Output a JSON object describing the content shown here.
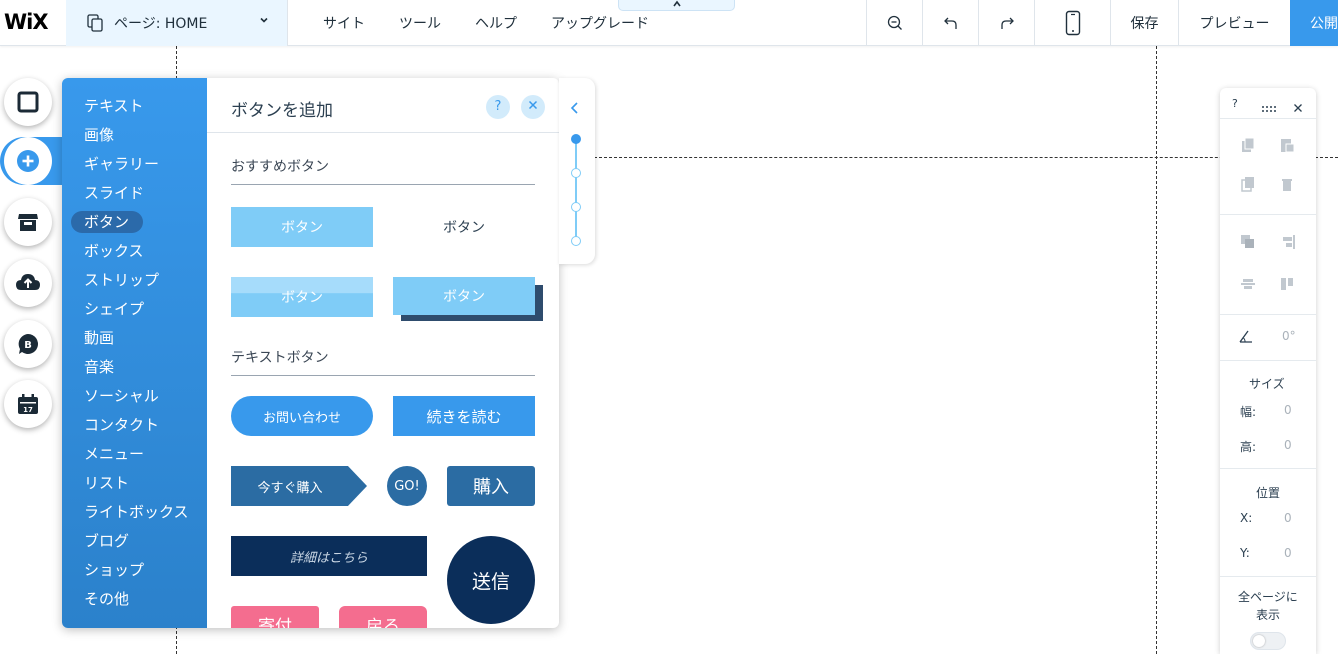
{
  "topbar": {
    "logo": "WiX",
    "page_label": "ページ: HOME",
    "menu": [
      "サイト",
      "ツール",
      "ヘルプ",
      "アップグレード"
    ],
    "save": "保存",
    "preview": "プレビュー",
    "publish": "公開"
  },
  "add_panel": {
    "categories": [
      "テキスト",
      "画像",
      "ギャラリー",
      "スライド",
      "ボタン",
      "ボックス",
      "ストリップ",
      "シェイプ",
      "動画",
      "音楽",
      "ソーシャル",
      "コンタクト",
      "メニュー",
      "リスト",
      "ライトボックス",
      "ブログ",
      "ショップ",
      "その他"
    ],
    "active_category": "ボタン",
    "title": "ボタンを追加",
    "help": "?",
    "section_recommended": "おすすめボタン",
    "section_text": "テキストボタン",
    "buttons": {
      "b1": "ボタン",
      "b2": "ボタン",
      "b3": "ボタン",
      "b4": "ボタン",
      "contact": "お問い合わせ",
      "read_more": "続きを読む",
      "buy_now": "今すぐ購入",
      "go": "GO!",
      "purchase": "購入",
      "details": "詳細はこちら",
      "send": "送信",
      "donate": "寄付",
      "back": "戻る"
    }
  },
  "inspector": {
    "help": "?",
    "rotation_value": "0°",
    "size_title": "サイズ",
    "width_label": "幅:",
    "width_value": "0",
    "height_label": "高:",
    "height_value": "0",
    "position_title": "位置",
    "x_label": "X:",
    "x_value": "0",
    "y_label": "Y:",
    "y_value": "0",
    "all_pages_line1": "全ページに",
    "all_pages_line2": "表示"
  },
  "colors": {
    "accent": "#3899ec",
    "light_blue_btn": "#7fccf7",
    "dark_blue_btn": "#2b6ca3",
    "navy_btn": "#0b2e5a",
    "pink_btn": "#f46d8f"
  }
}
